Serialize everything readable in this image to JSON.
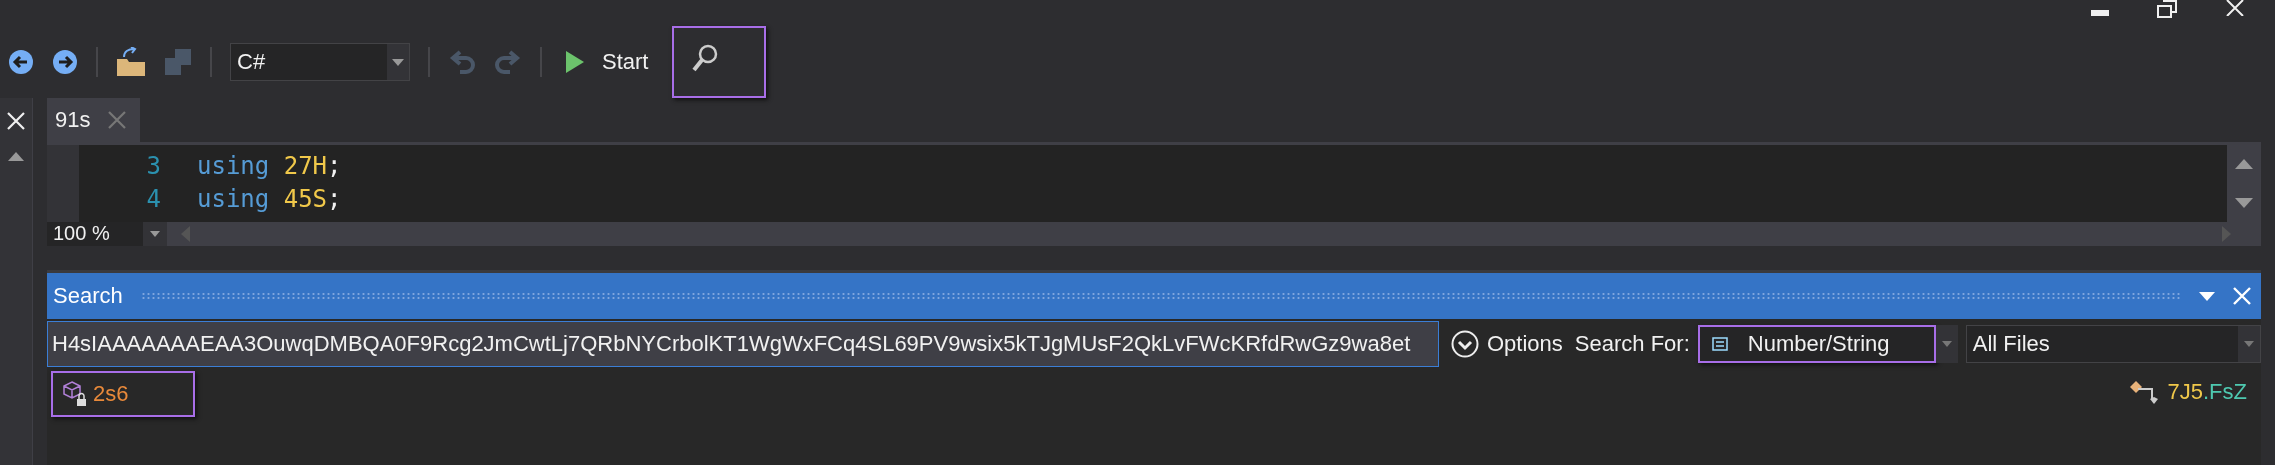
{
  "toolbar": {
    "language": "C#",
    "start_label": "Start",
    "search_button": {
      "highlighted": true
    }
  },
  "tabs": [
    {
      "label": "91s",
      "selected": true
    }
  ],
  "editor": {
    "lines": [
      {
        "number": "3",
        "keyword": "using",
        "name": "27H",
        "end": ";"
      },
      {
        "number": "4",
        "keyword": "using",
        "name": "45S",
        "end": ";"
      }
    ],
    "zoom": "100 %"
  },
  "search_panel": {
    "title": "Search",
    "query": "H4sIAAAAAAAEAA3OuwqDMBQA0F9Rcg2JmCwtLj7QRbNYCrbolKT1WgWxFCq4SL69PV9wsix5kTJgMUsF2QkLvFWcKRfdRwGz9wa8et",
    "options_label": "Options",
    "search_for_label": "Search For:",
    "search_for": {
      "value": "Number/String",
      "highlighted": true
    },
    "scope": "All Files",
    "results": [
      {
        "name": "2s6",
        "highlighted": true
      }
    ],
    "location": {
      "namespace": "7J5",
      "type": ".FsZ"
    }
  }
}
